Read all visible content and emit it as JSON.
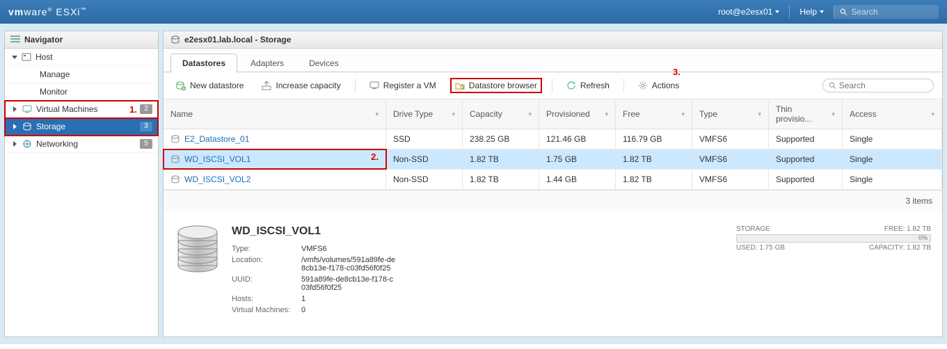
{
  "topbar": {
    "brand_html_a": "vm",
    "brand_html_b": "ware",
    "brand_suffix": " ESXi",
    "user": "root@e2esx01",
    "help": "Help",
    "search_placeholder": "Search"
  },
  "nav": {
    "title": "Navigator",
    "host": "Host",
    "manage": "Manage",
    "monitor": "Monitor",
    "vms": "Virtual Machines",
    "vms_badge": "2",
    "storage": "Storage",
    "storage_badge": "3",
    "networking": "Networking",
    "networking_badge": "5",
    "annot_1": "1."
  },
  "breadcrumb": "e2esx01.lab.local - Storage",
  "tabs": {
    "datastores": "Datastores",
    "adapters": "Adapters",
    "devices": "Devices"
  },
  "toolbar": {
    "new_ds": "New datastore",
    "inc_cap": "Increase capacity",
    "register_vm": "Register a VM",
    "ds_browser": "Datastore browser",
    "refresh": "Refresh",
    "actions": "Actions",
    "search_placeholder": "Search",
    "annot_3": "3."
  },
  "columns": {
    "name": "Name",
    "drive": "Drive Type",
    "capacity": "Capacity",
    "provisioned": "Provisioned",
    "free": "Free",
    "type": "Type",
    "thin": "Thin provisio...",
    "access": "Access"
  },
  "rows": [
    {
      "name": "E2_Datastore_01",
      "drive": "SSD",
      "cap": "238.25 GB",
      "prov": "121.46 GB",
      "free": "116.79 GB",
      "type": "VMFS6",
      "thin": "Supported",
      "access": "Single",
      "selected": false,
      "hl": false
    },
    {
      "name": "WD_ISCSI_VOL1",
      "drive": "Non-SSD",
      "cap": "1.82 TB",
      "prov": "1.75 GB",
      "free": "1.82 TB",
      "type": "VMFS6",
      "thin": "Supported",
      "access": "Single",
      "selected": true,
      "hl": true
    },
    {
      "name": "WD_ISCSI_VOL2",
      "drive": "Non-SSD",
      "cap": "1.82 TB",
      "prov": "1.44 GB",
      "free": "1.82 TB",
      "type": "VMFS6",
      "thin": "Supported",
      "access": "Single",
      "selected": false,
      "hl": false
    }
  ],
  "annot_2": "2.",
  "footer_items": "3 items",
  "detail": {
    "title": "WD_ISCSI_VOL1",
    "props": [
      {
        "k": "Type:",
        "v": "VMFS6"
      },
      {
        "k": "Location:",
        "v": "/vmfs/volumes/591a89fe-de8cb13e-f178-c03fd56f0f25"
      },
      {
        "k": "UUID:",
        "v": "591a89fe-de8cb13e-f178-c03fd56f0f25"
      },
      {
        "k": "Hosts:",
        "v": "1"
      },
      {
        "k": "Virtual Machines:",
        "v": "0"
      }
    ],
    "storage_label": "STORAGE",
    "free_label": "FREE: 1.82 TB",
    "used_label": "USED: 1.75 GB",
    "capacity_label": "CAPACITY: 1.82 TB",
    "pct": "0%"
  }
}
